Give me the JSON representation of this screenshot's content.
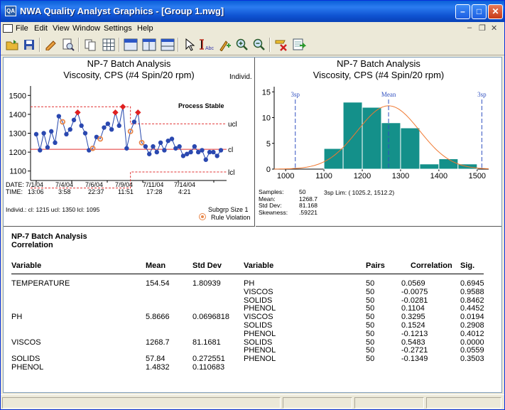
{
  "window": {
    "title": "NWA Quality Analyst Graphics - [Group 1.nwg]"
  },
  "menu": [
    "File",
    "Edit",
    "View",
    "Window",
    "Settings",
    "Help"
  ],
  "toolbar_icons": [
    "open-icon",
    "save-icon",
    "edit-icon",
    "print-preview-icon",
    "copy-icon",
    "grid-icon",
    "layout-1-icon",
    "layout-2-icon",
    "layout-3-icon",
    "pointer-icon",
    "text-icon",
    "annotate-icon",
    "zoom-in-icon",
    "zoom-out-icon",
    "clear-icon",
    "export-icon"
  ],
  "control_chart": {
    "title1": "NP-7 Batch Analysis",
    "title2": "Viscosity, CPS (#4 Spin/20 rpm)",
    "chart_label": "Individ.",
    "annotation": "Process Stable",
    "y_ticks": [
      "1500",
      "1400",
      "1300",
      "1200",
      "1100"
    ],
    "limit_labels": [
      "ucl",
      "cl",
      "lcl"
    ],
    "date_label": "DATE:",
    "time_label": "TIME:",
    "dates": [
      "7/1/04",
      "7/4/04",
      "7/6/04",
      "7/9/04",
      "7/11/04",
      "7/14/04"
    ],
    "times": [
      "13:06",
      "3:58",
      "22:37",
      "11:51",
      "17:28",
      "4:21"
    ],
    "footer": "Individ.: cl: 1215  ucl: 1350  lcl: 1095",
    "subgroup": "Subgrp Size 1",
    "legend": "Rule Violation"
  },
  "histogram": {
    "title1": "NP-7 Batch Analysis",
    "title2": "Viscosity, CPS (#4 Spin/20 rpm)",
    "y_ticks": [
      "15",
      "10",
      "5",
      "0"
    ],
    "x_ticks": [
      "1000",
      "1100",
      "1200",
      "1300",
      "1400",
      "1500"
    ],
    "mean_label": "Mean",
    "sp_left": "3sp",
    "sp_right": "3sp",
    "stats": [
      [
        "Samples:",
        "50"
      ],
      [
        "Mean:",
        "1268.7"
      ],
      [
        "Std Dev:",
        "81.168"
      ],
      [
        "Skewness:",
        ".59221"
      ]
    ],
    "limits": "3sp Lim: ( 1025.2,  1512.2)"
  },
  "correlation": {
    "title1": "NP-7 Batch Analysis",
    "title2": "Correlation",
    "headers": [
      "Variable",
      "Mean",
      "Std Dev",
      "Variable",
      "Pairs",
      "Correlation",
      "Sig."
    ],
    "rows": [
      [
        "TEMPERATURE",
        "154.54",
        "1.80939",
        "PH",
        "50",
        "0.0569",
        "0.6945"
      ],
      [
        "",
        "",
        "",
        "VISCOS",
        "50",
        "-0.0075",
        "0.9588"
      ],
      [
        "",
        "",
        "",
        "SOLIDS",
        "50",
        "-0.0281",
        "0.8462"
      ],
      [
        "",
        "",
        "",
        "PHENOL",
        "50",
        "0.1104",
        "0.4452"
      ],
      [
        "PH",
        "5.8666",
        "0.0696818",
        "VISCOS",
        "50",
        "0.3295",
        "0.0194"
      ],
      [
        "",
        "",
        "",
        "SOLIDS",
        "50",
        "0.1524",
        "0.2908"
      ],
      [
        "",
        "",
        "",
        "PHENOL",
        "50",
        "-0.1213",
        "0.4012"
      ],
      [
        "VISCOS",
        "1268.7",
        "81.1681",
        "SOLIDS",
        "50",
        "0.5483",
        "0.0000"
      ],
      [
        "",
        "",
        "",
        "PHENOL",
        "50",
        "-0.2721",
        "0.0559"
      ],
      [
        "SOLIDS",
        "57.84",
        "0.272551",
        "PHENOL",
        "50",
        "-0.1349",
        "0.3503"
      ],
      [
        "PHENOL",
        "1.4832",
        "0.110683",
        "",
        "",
        "",
        ""
      ]
    ]
  },
  "chart_data": [
    {
      "type": "line",
      "title": "NP-7 Batch Analysis Viscosity, CPS (#4 Spin/20 rpm)",
      "ylabel": "Individ.",
      "ylim": [
        1050,
        1550
      ],
      "series": [
        {
          "name": "Individ.",
          "values": [
            1295,
            1210,
            1300,
            1225,
            1310,
            1250,
            1390,
            1360,
            1295,
            1320,
            1370,
            1410,
            1340,
            1300,
            1210,
            1220,
            1280,
            1270,
            1330,
            1350,
            1320,
            1410,
            1340,
            1440,
            1220,
            1310,
            1360,
            1410,
            1250,
            1230,
            1190,
            1230,
            1200,
            1250,
            1210,
            1260,
            1270,
            1220,
            1230,
            1180,
            1190,
            1200,
            1230,
            1200,
            1210,
            1160,
            1200,
            1200,
            1180,
            1210
          ]
        }
      ],
      "center_line": 1215,
      "ucl": [
        1440,
        1350
      ],
      "lcl": [
        1010,
        1095
      ],
      "rule_violations": [
        7,
        15,
        17,
        25,
        28
      ]
    },
    {
      "type": "bar",
      "title": "NP-7 Batch Analysis Viscosity, CPS (#4 Spin/20 rpm)",
      "categories": [
        "1125",
        "1175",
        "1225",
        "1275",
        "1325",
        "1375",
        "1425",
        "1475"
      ],
      "values": [
        4,
        13,
        12,
        9,
        8,
        1,
        2,
        1
      ],
      "ylim": [
        0,
        16
      ],
      "xlim": [
        970,
        1530
      ],
      "mean": 1268.7,
      "sp_limits": [
        1025.2,
        1512.2
      ]
    }
  ]
}
